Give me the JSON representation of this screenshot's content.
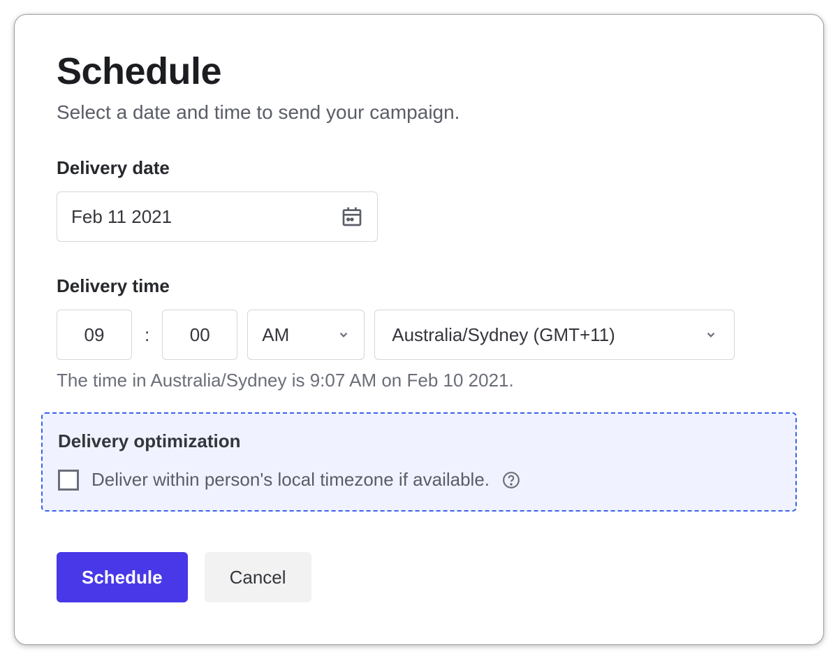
{
  "header": {
    "title": "Schedule",
    "subtitle": "Select a date and time to send your campaign."
  },
  "delivery_date": {
    "label": "Delivery date",
    "value": "Feb 11 2021"
  },
  "delivery_time": {
    "label": "Delivery time",
    "hour": "09",
    "minute": "00",
    "ampm": "AM",
    "timezone": "Australia/Sydney (GMT+11)",
    "hint": "The time in Australia/Sydney is 9:07 AM on Feb 10 2021."
  },
  "optimization": {
    "title": "Delivery optimization",
    "checkbox_label": "Deliver within person's local timezone if available."
  },
  "buttons": {
    "schedule": "Schedule",
    "cancel": "Cancel"
  }
}
